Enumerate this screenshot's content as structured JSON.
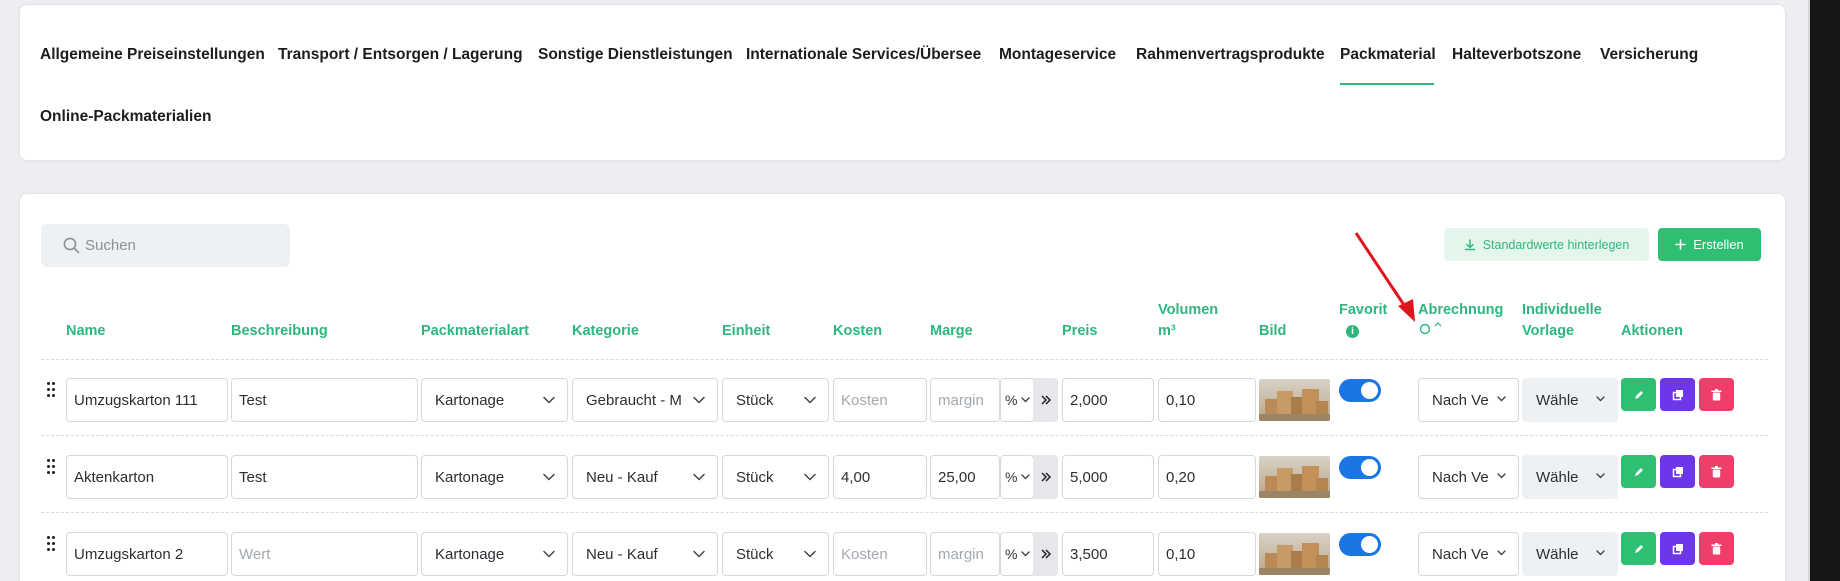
{
  "tabs": [
    {
      "label": "Allgemeine Preiseinstellungen"
    },
    {
      "label": "Transport / Entsorgen / Lagerung"
    },
    {
      "label": "Sonstige Dienstleistungen"
    },
    {
      "label": "Internationale Services/Übersee"
    },
    {
      "label": "Montageservice"
    },
    {
      "label": "Rahmenvertragsprodukte"
    },
    {
      "label": "Packmaterial"
    },
    {
      "label": "Halteverbotszone"
    },
    {
      "label": "Versicherung"
    },
    {
      "label": "Online-Packmaterialien"
    }
  ],
  "active_tab": "Packmaterial",
  "search": {
    "placeholder": "Suchen"
  },
  "toolbar": {
    "standard_label": "Standardwerte hinterlegen",
    "create_label": "Erstellen"
  },
  "columns": {
    "name": "Name",
    "beschreibung": "Beschreibung",
    "packmaterialart": "Packmaterialart",
    "kategorie": "Kategorie",
    "einheit": "Einheit",
    "kosten": "Kosten",
    "marge": "Marge",
    "preis": "Preis",
    "volumen_1": "Volumen",
    "volumen_2": "m³",
    "bild": "Bild",
    "favorit": "Favorit",
    "abrechnung": "Abrechnung",
    "vorlage_1": "Individuelle",
    "vorlage_2": "Vorlage",
    "aktionen": "Aktionen"
  },
  "rows": [
    {
      "name": "Umzugskarton 111",
      "beschreibung": "Test",
      "beschreibung_placeholder": "Wert",
      "art": "Kartonage",
      "kategorie": "Gebraucht - M",
      "einheit": "Stück",
      "kosten": "",
      "kosten_placeholder": "Kosten",
      "marge": "",
      "marge_placeholder": "margin",
      "marge_type": "%",
      "preis": "2,000",
      "volumen": "0,10",
      "favorit": true,
      "abrechnung": "Nach Ve",
      "vorlage": "Wähle"
    },
    {
      "name": "Aktenkarton",
      "beschreibung": "Test",
      "beschreibung_placeholder": "Wert",
      "art": "Kartonage",
      "kategorie": "Neu - Kauf",
      "einheit": "Stück",
      "kosten": "4,00",
      "kosten_placeholder": "Kosten",
      "marge": "25,00",
      "marge_placeholder": "margin",
      "marge_type": "%",
      "preis": "5,000",
      "volumen": "0,20",
      "favorit": true,
      "abrechnung": "Nach Ve",
      "vorlage": "Wähle"
    },
    {
      "name": "Umzugskarton 2",
      "beschreibung": "",
      "beschreibung_placeholder": "Wert",
      "art": "Kartonage",
      "kategorie": "Neu - Kauf",
      "einheit": "Stück",
      "kosten": "",
      "kosten_placeholder": "Kosten",
      "marge": "",
      "marge_placeholder": "margin",
      "marge_type": "%",
      "preis": "3,500",
      "volumen": "0,10",
      "favorit": true,
      "abrechnung": "Nach Ve",
      "vorlage": "Wähle"
    }
  ],
  "colors": {
    "accent": "#2fb67c",
    "toggle": "#1976e4",
    "copy": "#6e36e9",
    "delete": "#f03e6a",
    "annotation_arrow": "#e0161e"
  },
  "icons": {
    "search": "search-icon",
    "download": "download-icon",
    "plus": "plus-icon",
    "edit": "pencil-icon",
    "copy": "copy-icon",
    "delete": "trash-icon",
    "info": "info-icon",
    "sort": "sort-icon",
    "drag": "drag-handle-icon"
  }
}
